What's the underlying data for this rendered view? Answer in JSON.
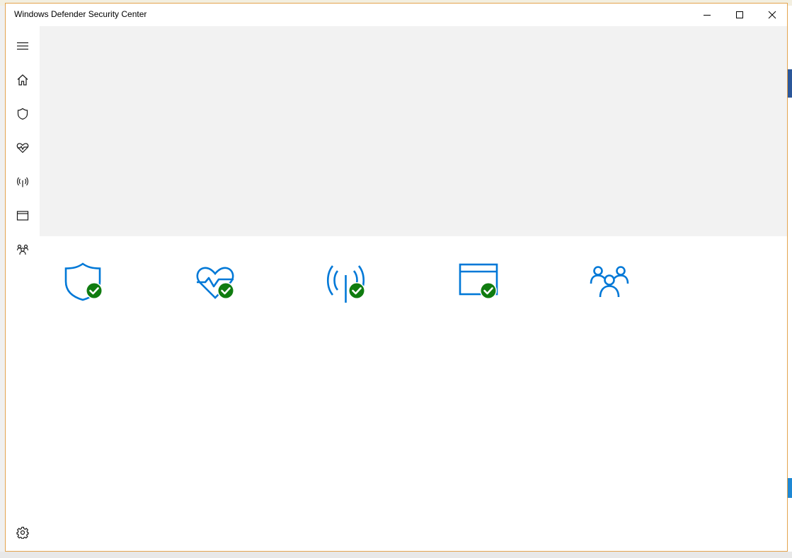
{
  "window": {
    "title": "Windows Defender Security Center"
  },
  "titlebar_buttons": {
    "minimize_icon": "minimize-icon",
    "maximize_icon": "maximize-icon",
    "close_icon": "close-icon"
  },
  "nav": {
    "items": [
      {
        "icon": "hamburger-menu-icon"
      },
      {
        "icon": "home-icon"
      },
      {
        "icon": "shield-icon"
      },
      {
        "icon": "heart-pulse-icon"
      },
      {
        "icon": "wireless-antenna-icon"
      },
      {
        "icon": "app-browser-icon"
      },
      {
        "icon": "family-icon"
      }
    ],
    "settings_icon": "gear-icon"
  },
  "tiles": [
    {
      "icon": "shield-icon",
      "status": "ok"
    },
    {
      "icon": "heart-pulse-icon",
      "status": "ok"
    },
    {
      "icon": "wireless-antenna-icon",
      "status": "ok"
    },
    {
      "icon": "app-browser-icon",
      "status": "ok"
    },
    {
      "icon": "family-icon",
      "status": "none"
    }
  ],
  "colors": {
    "accent": "#0078d7",
    "ok_badge": "#107c10",
    "hero_bg": "#f2f2f2",
    "window_border": "#e3a34e"
  }
}
